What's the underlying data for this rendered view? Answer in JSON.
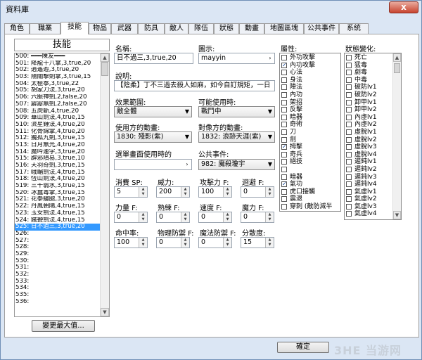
{
  "window": {
    "title": "資料庫",
    "close_glyph": "x"
  },
  "tabs": [
    "角色",
    "職業",
    "技能",
    "物品",
    "武器",
    "防具",
    "敵人",
    "隊伍",
    "狀態",
    "動畫",
    "地圖區塊",
    "公共事件",
    "系統"
  ],
  "active_tab": "技能",
  "list": {
    "header": "技能",
    "items": [
      "500: ═══陳友═══",
      "501: 降龍十八掌,3,true,20",
      "502: 逍遙遊,3,true,20",
      "503: 陽關擊劍掌,3,true,15",
      "504: 太極拳,3,true,22",
      "505: 胡家刀法,3,true,20",
      "506: 六脈神劍,2,false,20",
      "507: 霹靂無劍,2,false,20",
      "508: 五虎斷,4,true,20",
      "509: 華山劍法,4,true,15",
      "510: 流星錘法,4,true,20",
      "511: 化骨綿掌,4,true,20",
      "512: 獨孤九劍,3,true,15",
      "513: 日月無光,4,true,20",
      "514: 魔吟連字,3,true,20",
      "515: 辟邪隕易,3,true,10",
      "516: 天羽奇劍,3,true,15",
      "517: 峨嵋劍法,4,true,15",
      "518: 恆山劍法,4,true,20",
      "519: 三千弱水,3,true,15",
      "520: 冰蠶毒掌,3,true,15",
      "521: 花拳繡腿,3,true,20",
      "522: 丹鳳朝陽,4,true,15",
      "523: 玉女劍法,4,true,15",
      "524: 鐵鞭劍法,4,true,15",
      "525: 日不過三,3,true,20",
      "526:",
      "527:",
      "528:",
      "529:",
      "530:",
      "531:",
      "532:",
      "533:",
      "534:",
      "535:",
      "536:"
    ],
    "selected_index": 25,
    "max_button": "變更最大值..."
  },
  "form": {
    "name_label": "名稱:",
    "name_value": "日不過三,3,true,20",
    "icon_label": "圖示:",
    "icon_value": "mayyin",
    "desc_label": "說明:",
    "desc_value": "【陰柔】丁不三過去殺人如麻，如今自訂規矩，一日",
    "scope_label": "效果範圍:",
    "scope_value": "敵全體",
    "occasion_label": "可能使用時:",
    "occasion_value": "戰鬥中",
    "user_anim_label": "使用方的動畫:",
    "user_anim_value": "1830: 殘影(紫)",
    "target_anim_label": "對像方的動畫:",
    "target_anim_value": "1832: 浪跡天涯(紫)",
    "menu_se_label": "選單畫面使用時的",
    "menu_se_value": "",
    "common_event_label": "公共事件:",
    "common_event_value": "982: 魔殺瓊宇",
    "sp_label": "消費 SP:",
    "sp_value": "5",
    "power_label": "威力:",
    "power_value": "200",
    "atk_f_label": "攻擊力 F:",
    "atk_f_value": "100",
    "eva_f_label": "迴避 F:",
    "eva_f_value": "0",
    "str_f_label": "力量 F:",
    "str_f_value": "0",
    "dex_f_label": "熟練 F:",
    "dex_f_value": "0",
    "agi_f_label": "速度 F:",
    "agi_f_value": "0",
    "int_f_label": "魔力 F:",
    "int_f_value": "0",
    "hit_label": "命中率:",
    "hit_value": "100",
    "pdef_f_label": "物理防禦 F:",
    "pdef_f_value": "0",
    "mdef_f_label": "魔法防禦 F:",
    "mdef_f_value": "0",
    "variance_label": "分散度:",
    "variance_value": "15"
  },
  "attributes": {
    "label": "屬性:",
    "items": [
      {
        "name": "外功攻擊",
        "checked": false
      },
      {
        "name": "內功攻擊",
        "checked": true
      },
      {
        "name": "心法",
        "checked": false
      },
      {
        "name": "身法",
        "checked": false
      },
      {
        "name": "陣法",
        "checked": false
      },
      {
        "name": "內功",
        "checked": false
      },
      {
        "name": "架招",
        "checked": false
      },
      {
        "name": "反擊",
        "checked": false
      },
      {
        "name": "暗器",
        "checked": false
      },
      {
        "name": "奇術",
        "checked": false
      },
      {
        "name": "刀",
        "checked": false
      },
      {
        "name": "劍",
        "checked": false
      },
      {
        "name": "拇擊",
        "checked": true
      },
      {
        "name": "奇兵",
        "checked": false
      },
      {
        "name": "絕技",
        "checked": false
      },
      {
        "name": "",
        "checked": false
      },
      {
        "name": "暗器",
        "checked": false
      },
      {
        "name": "氣功",
        "checked": true
      },
      {
        "name": "虎口接觸",
        "checked": false
      },
      {
        "name": "震退",
        "checked": false
      },
      {
        "name": "穿刺 (敵防減半",
        "checked": false
      }
    ]
  },
  "states": {
    "label": "狀態變化:",
    "items": [
      "死亡",
      "猛毒",
      "劇毒",
      "中毒",
      "破防lv1",
      "破防lv2",
      "卸甲lv1",
      "卸甲lv2",
      "內虛lv1",
      "內虛lv2",
      "虛脫lv1",
      "虛脫lv2",
      "虛脫lv3",
      "虛脫lv4",
      "遲鈍lv1",
      "遲鈍lv2",
      "遲鈍lv3",
      "遲鈍lv4",
      "氣虛lv1",
      "氣虛lv2",
      "氣虛lv3",
      "氣虛lv4"
    ]
  },
  "buttons": {
    "ok": "確定"
  },
  "watermark": "3HE 当游网"
}
